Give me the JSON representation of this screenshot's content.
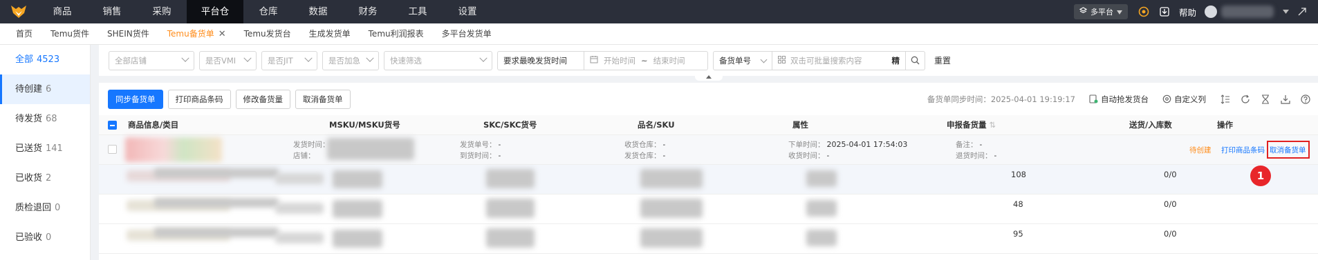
{
  "nav": {
    "items": [
      "商品",
      "销售",
      "采购",
      "平台仓",
      "仓库",
      "数据",
      "财务",
      "工具",
      "设置"
    ],
    "active_index": 3,
    "platform_label": "多平台",
    "help_label": "帮助"
  },
  "tabs": [
    {
      "label": "首页"
    },
    {
      "label": "Temu货件"
    },
    {
      "label": "SHEIN货件"
    },
    {
      "label": "Temu备货单",
      "active": true
    },
    {
      "label": "Temu发货台"
    },
    {
      "label": "生成发货单"
    },
    {
      "label": "Temu利润报表"
    },
    {
      "label": "多平台发货单"
    }
  ],
  "sidebar": {
    "items": [
      {
        "label": "全部",
        "count": "4523"
      },
      {
        "label": "待创建",
        "count": "6"
      },
      {
        "label": "待发货",
        "count": "68"
      },
      {
        "label": "已送货",
        "count": "141"
      },
      {
        "label": "已收货",
        "count": "2"
      },
      {
        "label": "质检退回",
        "count": "0"
      },
      {
        "label": "已验收",
        "count": "0"
      }
    ]
  },
  "filters": {
    "shop": "全部店铺",
    "vmi": "是否VMI",
    "jit": "是否JIT",
    "urgent": "是否加急",
    "quick": "快速筛选",
    "time_type": "要求最晚发货时间",
    "start_time": "开始时间",
    "range_sep": "~",
    "end_time": "结束时间",
    "order_field": "备货单号",
    "batch_placeholder": "双击可批量搜索内容",
    "exact_label": "精",
    "reset_label": "重置"
  },
  "toolbar": {
    "sync_label": "同步备货单",
    "print_label": "打印商品条码",
    "modify_label": "修改备货量",
    "cancel_label": "取消备货单",
    "sync_time": "备货单同步时间：2025-04-01 19:19:17",
    "auto_label": "自动抢发货台",
    "custom_cols_label": "自定义列"
  },
  "table": {
    "columns": [
      "商品信息/类目",
      "MSKU/MSKU货号",
      "SKC/SKC货号",
      "品名/SKU",
      "属性",
      "申报备货量",
      "送货/入库数",
      "操作"
    ],
    "order": {
      "ship_time_label": "发货时间：",
      "store_label": "店铺：",
      "ship_no_label": "发货单号：",
      "ship_no": "-",
      "arrive_label": "到货时间：",
      "arrive": "-",
      "recv_wh_label": "收货仓库：",
      "recv_wh": "-",
      "ship_wh_label": "发货仓库：",
      "ship_wh": "-",
      "order_time_label": "下单时间：",
      "order_time": "2025-04-01 17:54:03",
      "recv_time_label": "收货时间：",
      "recv_time": "-",
      "remark_label": "备注：",
      "remark": "-",
      "return_label": "退货时间：",
      "return_time": "-",
      "status": "待创建",
      "print_action": "打印商品条码",
      "cancel_action": "取消备货单"
    },
    "rows": [
      {
        "declared": "108",
        "delivered": "0/0"
      },
      {
        "declared": "48",
        "delivered": "0/0"
      },
      {
        "declared": "95",
        "delivered": "0/0"
      }
    ]
  },
  "annotation": {
    "marker": "1"
  },
  "colors": {
    "accent": "#1677ff",
    "active_tab": "#ff8c1a",
    "highlight": "#e02020",
    "nav_bg": "#2b2f3a"
  }
}
